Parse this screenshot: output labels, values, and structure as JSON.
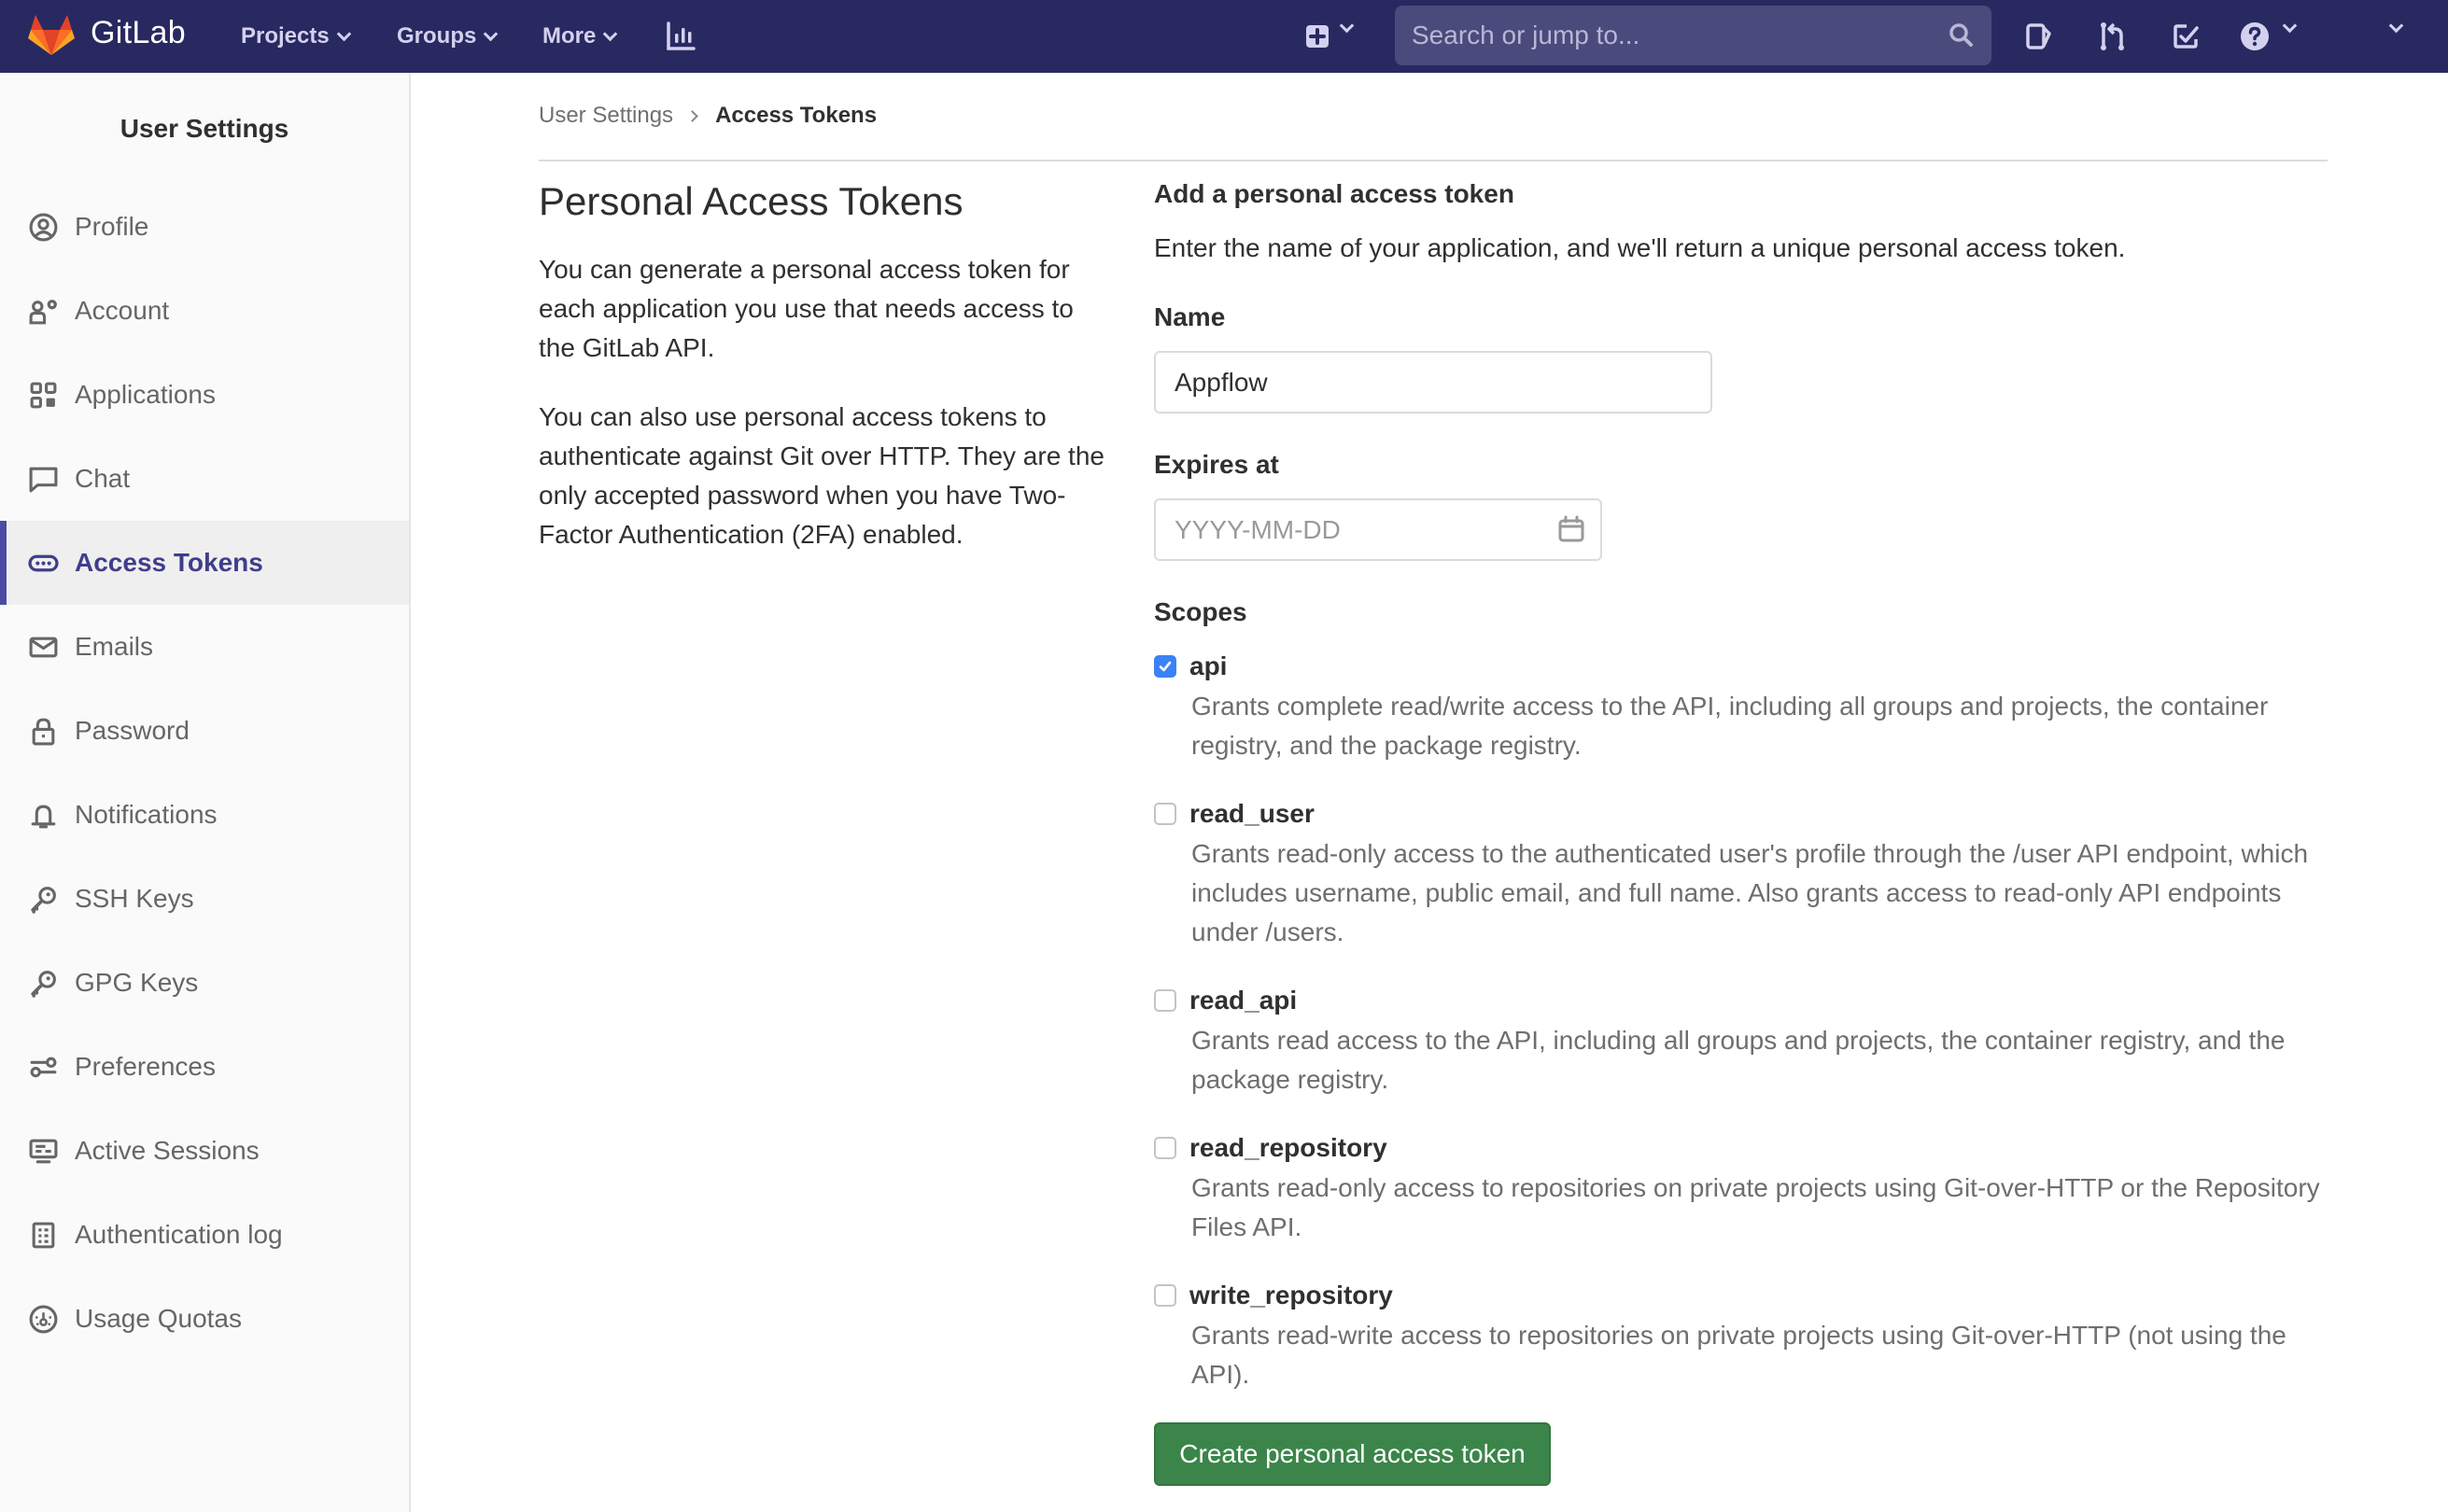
{
  "header": {
    "brand": "GitLab",
    "nav": [
      {
        "label": "Projects",
        "icon": "chevron-down-icon"
      },
      {
        "label": "Groups",
        "icon": "chevron-down-icon"
      },
      {
        "label": "More",
        "icon": "chevron-down-icon"
      }
    ],
    "search_placeholder": "Search or jump to...",
    "icons": [
      "activity-chart-icon",
      "plus-square-icon",
      "search-icon",
      "issues-icon",
      "merge-request-icon",
      "todo-icon",
      "help-icon",
      "user-menu-chevron-icon"
    ],
    "colors": {
      "background": "#292961",
      "text": "#d3d1ef",
      "search_bg": "#4a4a7c"
    }
  },
  "sidebar": {
    "title": "User Settings",
    "items": [
      {
        "label": "Profile",
        "icon": "profile-icon",
        "active": false
      },
      {
        "label": "Account",
        "icon": "account-icon",
        "active": false
      },
      {
        "label": "Applications",
        "icon": "applications-icon",
        "active": false
      },
      {
        "label": "Chat",
        "icon": "chat-icon",
        "active": false
      },
      {
        "label": "Access Tokens",
        "icon": "token-icon",
        "active": true
      },
      {
        "label": "Emails",
        "icon": "mail-icon",
        "active": false
      },
      {
        "label": "Password",
        "icon": "lock-icon",
        "active": false
      },
      {
        "label": "Notifications",
        "icon": "bell-icon",
        "active": false
      },
      {
        "label": "SSH Keys",
        "icon": "key-icon",
        "active": false
      },
      {
        "label": "GPG Keys",
        "icon": "key-icon",
        "active": false
      },
      {
        "label": "Preferences",
        "icon": "preferences-icon",
        "active": false
      },
      {
        "label": "Active Sessions",
        "icon": "monitor-icon",
        "active": false
      },
      {
        "label": "Authentication log",
        "icon": "log-icon",
        "active": false
      },
      {
        "label": "Usage Quotas",
        "icon": "quota-icon",
        "active": false
      }
    ],
    "colors": {
      "active_text": "#3f3e8c",
      "active_bar": "#4b4ba3"
    }
  },
  "breadcrumb": {
    "parent": "User Settings",
    "current": "Access Tokens"
  },
  "intro": {
    "title": "Personal Access Tokens",
    "paragraphs": [
      "You can generate a personal access token for each application you use that needs access to the GitLab API.",
      "You can also use personal access tokens to authenticate against Git over HTTP. They are the only accepted password when you have Two-Factor Authentication (2FA) enabled."
    ]
  },
  "form": {
    "title": "Add a personal access token",
    "description": "Enter the name of your application, and we'll return a unique personal access token.",
    "name_label": "Name",
    "name_value": "Appflow",
    "expires_label": "Expires at",
    "expires_value": "",
    "expires_placeholder": "YYYY-MM-DD",
    "scopes_label": "Scopes",
    "scopes": [
      {
        "name": "api",
        "checked": true,
        "description": "Grants complete read/write access to the API, including all groups and projects, the container registry, and the package registry."
      },
      {
        "name": "read_user",
        "checked": false,
        "description": "Grants read-only access to the authenticated user's profile through the /user API endpoint, which includes username, public email, and full name. Also grants access to read-only API endpoints under /users."
      },
      {
        "name": "read_api",
        "checked": false,
        "description": "Grants read access to the API, including all groups and projects, the container registry, and the package registry."
      },
      {
        "name": "read_repository",
        "checked": false,
        "description": "Grants read-only access to repositories on private projects using Git-over-HTTP or the Repository Files API."
      },
      {
        "name": "write_repository",
        "checked": false,
        "description": "Grants read-write access to repositories on private projects using Git-over-HTTP (not using the API)."
      }
    ],
    "submit_label": "Create personal access token",
    "colors": {
      "submit_bg": "#3b854a",
      "checkbox_checked": "#3b82f6"
    }
  }
}
